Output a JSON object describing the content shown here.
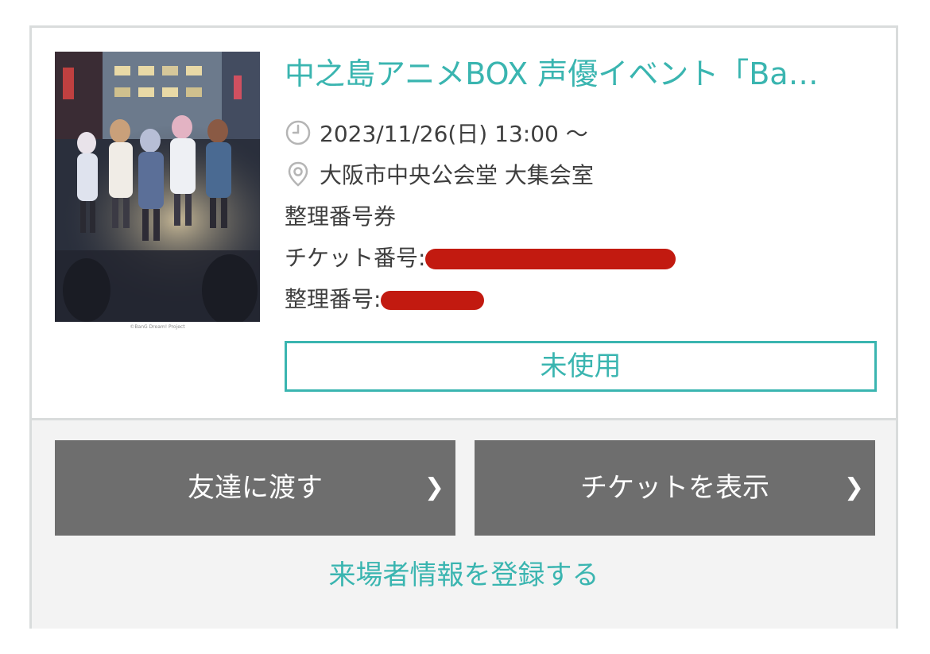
{
  "event": {
    "title": "中之島アニメBOX 声優イベント「Ba…",
    "date": "2023/11/26(日) 13:00 ～",
    "venue": "大阪市中央公会堂 大集会室",
    "ticket_type": "整理番号券",
    "ticket_number_label": "チケット番号:",
    "seat_number_label": "整理番号:",
    "poster_copyright": "©BanG Dream! Project"
  },
  "status_label": "未使用",
  "actions": {
    "give_to_friend": "友達に渡す",
    "show_ticket": "チケットを表示",
    "register_attendee": "来場者情報を登録する"
  },
  "icons": {
    "date": "clock-icon",
    "venue": "location-pin-icon",
    "chevron": "chevron-right-icon"
  },
  "colors": {
    "accent": "#3ab5b0",
    "button_bg": "#6e6e6e",
    "redaction": "#c21a10"
  }
}
